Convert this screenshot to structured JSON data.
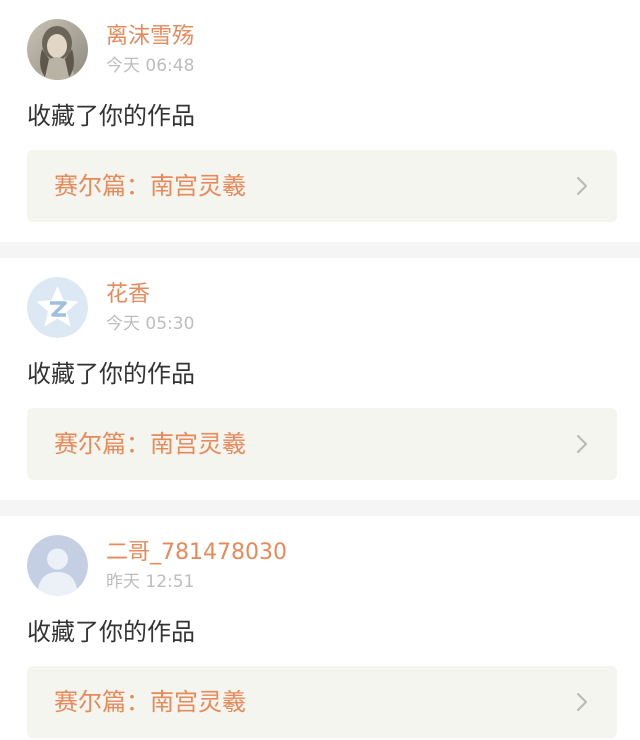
{
  "notifications": [
    {
      "user": "离沫雪殇",
      "time": "今天 06:48",
      "action": "收藏了你的作品",
      "work_title": "赛尔篇：南宫灵羲",
      "avatar": "photo-avatar-icon"
    },
    {
      "user": "花香",
      "time": "今天 05:30",
      "action": "收藏了你的作品",
      "work_title": "赛尔篇：南宫灵羲",
      "avatar": "qzone-star-avatar-icon"
    },
    {
      "user": "二哥_781478030",
      "time": "昨天 12:51",
      "action": "收藏了你的作品",
      "work_title": "赛尔篇：南宫灵羲",
      "avatar": "default-person-avatar-icon"
    }
  ],
  "colors": {
    "accent": "#e8895a",
    "work_card_bg": "#f5f5ef",
    "timestamp": "#bdbdbd",
    "text": "#333333",
    "separator": "#f5f5f5"
  }
}
